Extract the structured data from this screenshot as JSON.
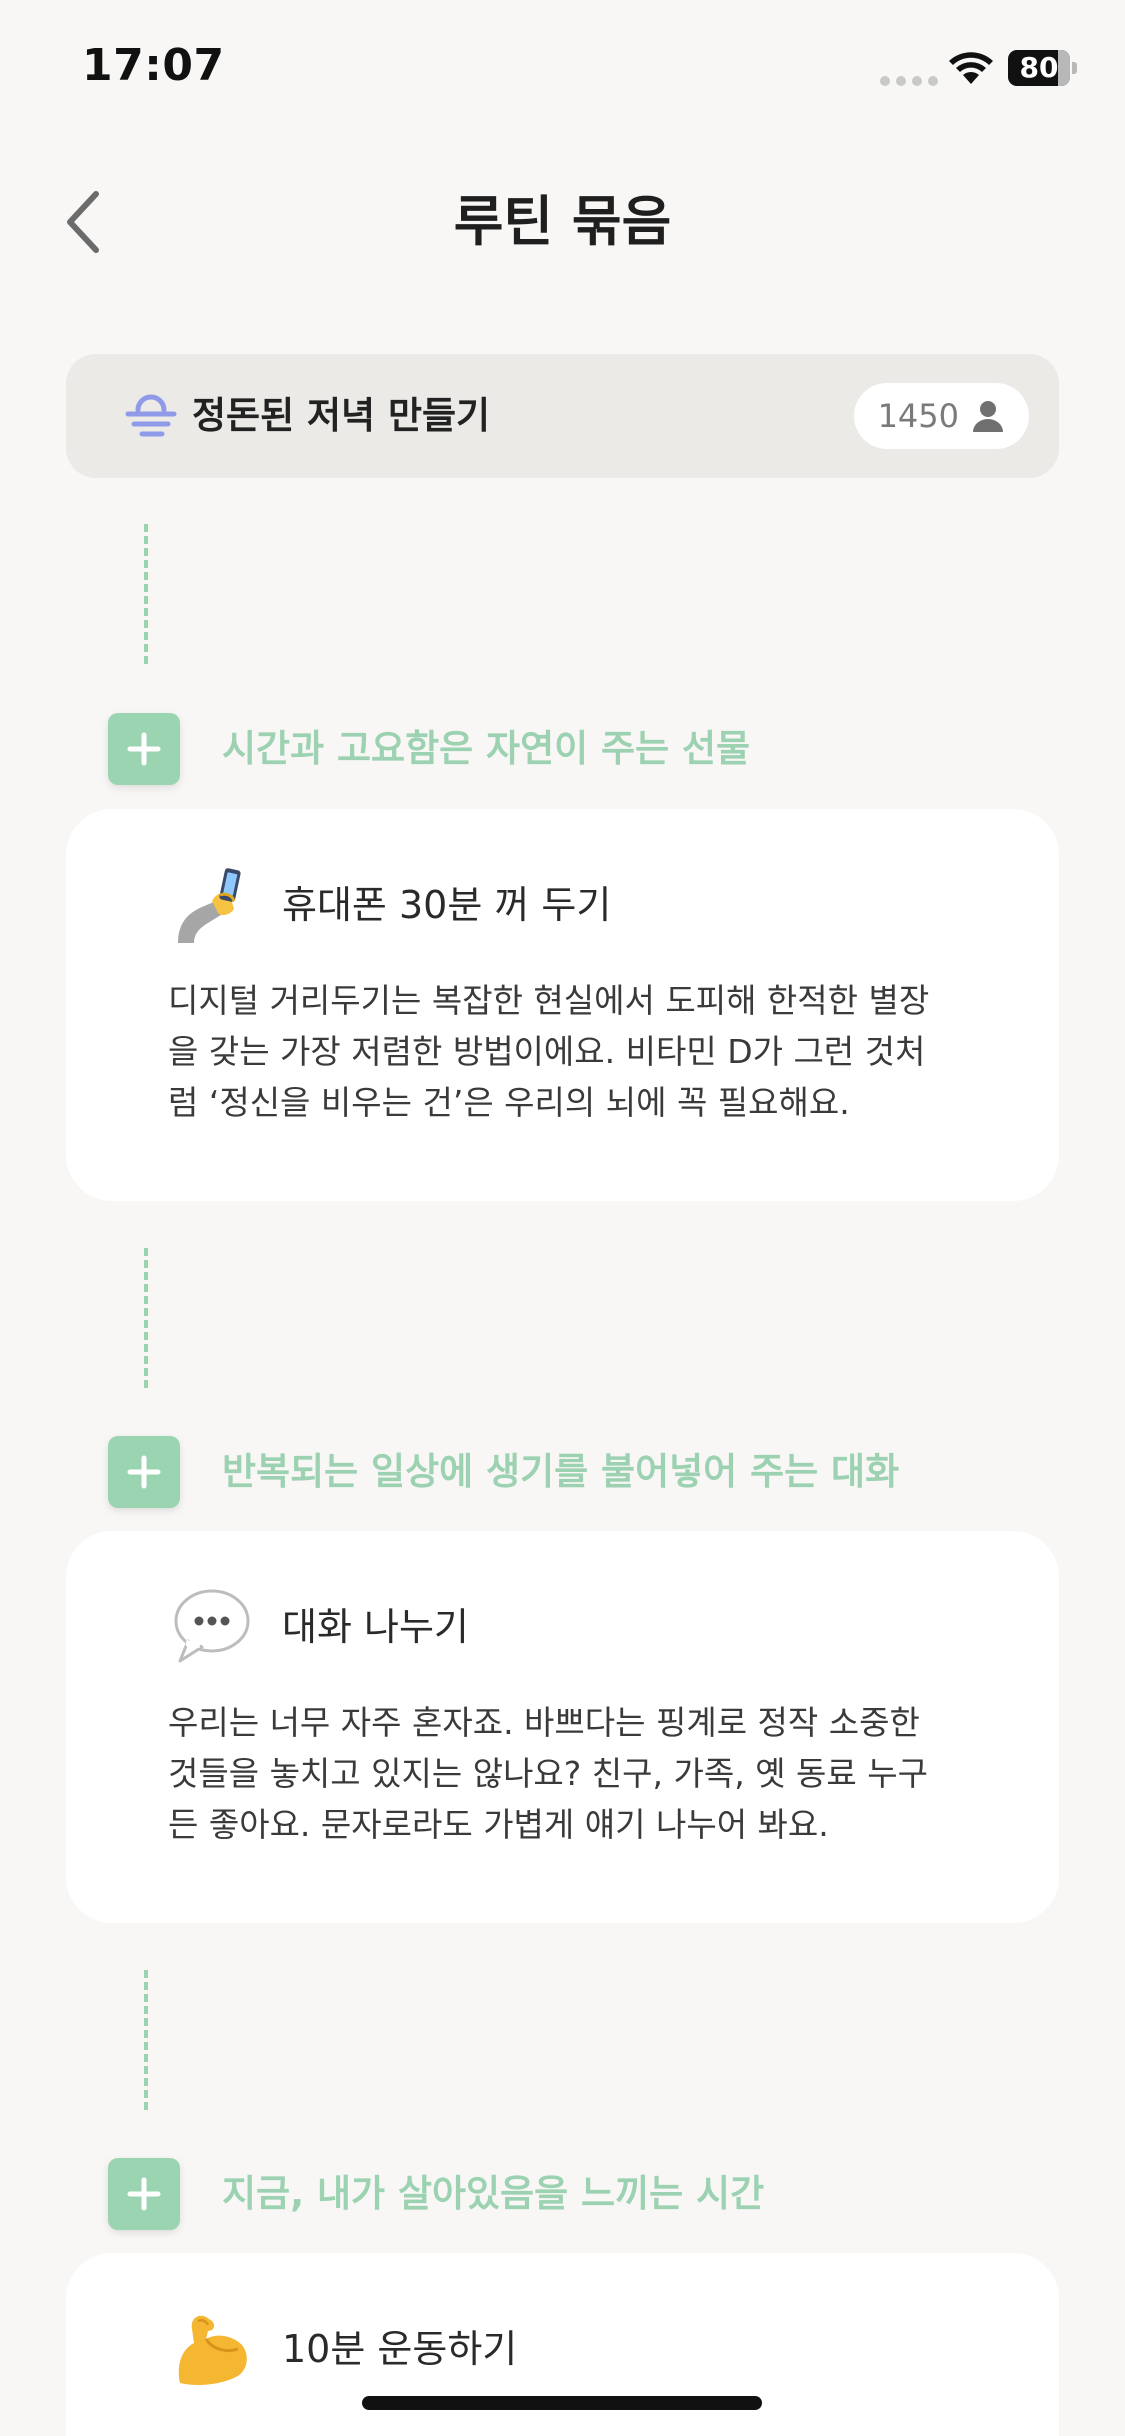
{
  "status_bar": {
    "time": "17:07",
    "battery": "80",
    "battery_level": 0.8
  },
  "header": {
    "title": "루틴 묶음"
  },
  "bundle": {
    "title": "정돈된 저녁 만들기",
    "participants": "1450"
  },
  "sections": [
    {
      "heading": "시간과 고요함은 자연이 주는 선물",
      "card_title": "휴대폰 30분 꺼 두기",
      "card_icon": "phone-in-hand-icon",
      "lines": [
        "디지털 거리두기는 복잡한 현실에서 도피해 한적한 별장",
        "을 갖는 가장 저렴한 방법이에요. 비타민 D가 그런 것처",
        "럼 ‘정신을 비우는 건’은 우리의 뇌에 꼭 필요해요."
      ]
    },
    {
      "heading": "반복되는 일상에 생기를 불어넣어 주는 대화",
      "card_title": "대화 나누기",
      "card_icon": "speech-bubble-icon",
      "lines": [
        "우리는 너무 자주 혼자죠. 바쁘다는 핑계로 정작 소중한",
        "것들을 놓치고 있지는 않나요? 친구, 가족, 옛 동료 누구",
        "든 좋아요. 문자로라도 가볍게 얘기 나누어 봐요."
      ]
    },
    {
      "heading": "지금, 내가 살아있음을 느끼는 시간",
      "card_title": "10분 운동하기",
      "card_icon": "flexed-biceps-icon",
      "lines": []
    }
  ],
  "colors": {
    "accent_green": "#9cd2b1",
    "background": "#f8f7f5",
    "banner": "#ebeae7",
    "bundle_icon": "#8f9be8"
  }
}
